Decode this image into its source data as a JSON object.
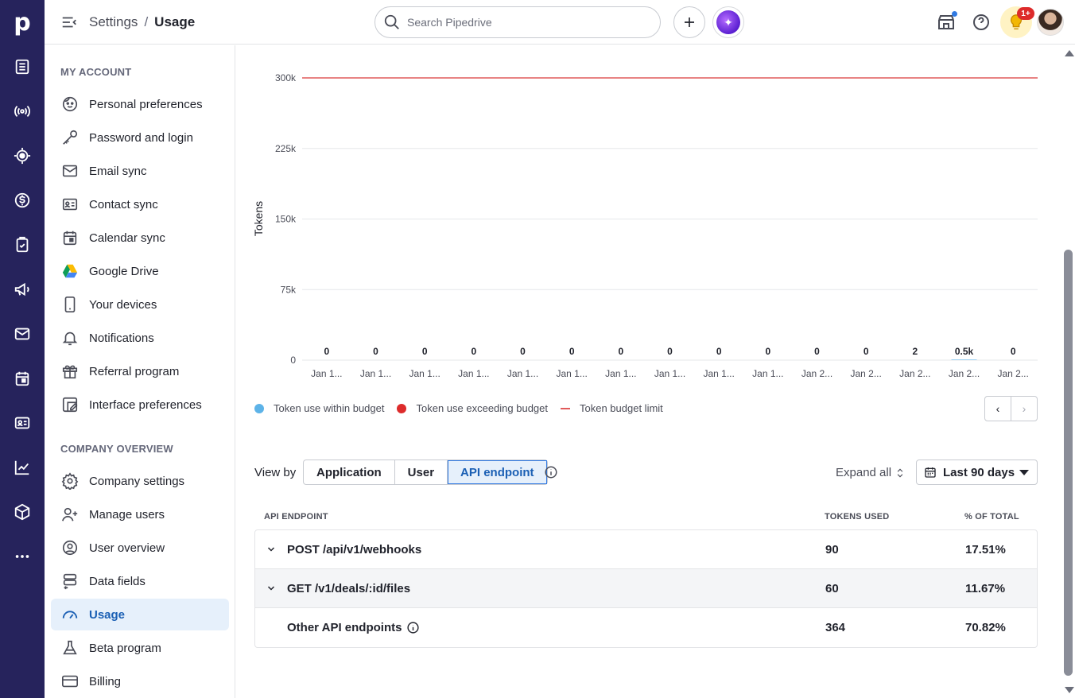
{
  "app": {
    "logo": "p"
  },
  "rail": {
    "items": [
      {
        "icon": "leads-icon"
      },
      {
        "icon": "broadcast-icon"
      },
      {
        "icon": "target-icon"
      },
      {
        "icon": "dollar-icon"
      },
      {
        "icon": "clipboard-icon"
      },
      {
        "icon": "megaphone-icon"
      },
      {
        "icon": "mail-icon"
      },
      {
        "icon": "calendar-icon"
      },
      {
        "icon": "contacts-icon"
      },
      {
        "icon": "chart-icon"
      },
      {
        "icon": "box-icon"
      },
      {
        "icon": "more-icon"
      }
    ]
  },
  "header": {
    "breadcrumb_root": "Settings",
    "breadcrumb_sep": "/",
    "breadcrumb_current": "Usage",
    "search_placeholder": "Search Pipedrive",
    "notification_badge": "1+"
  },
  "sidebar": {
    "section1": "MY ACCOUNT",
    "items1": [
      {
        "label": "Personal preferences",
        "icon": "face-icon"
      },
      {
        "label": "Password and login",
        "icon": "key-icon"
      },
      {
        "label": "Email sync",
        "icon": "envelope-icon"
      },
      {
        "label": "Contact sync",
        "icon": "contact-card-icon"
      },
      {
        "label": "Calendar sync",
        "icon": "calendar-icon"
      },
      {
        "label": "Google Drive",
        "icon": "google-drive-icon"
      },
      {
        "label": "Your devices",
        "icon": "phone-icon"
      },
      {
        "label": "Notifications",
        "icon": "bell-icon"
      },
      {
        "label": "Referral program",
        "icon": "gift-icon"
      },
      {
        "label": "Interface preferences",
        "icon": "interface-icon"
      }
    ],
    "section2": "COMPANY OVERVIEW",
    "items2": [
      {
        "label": "Company settings",
        "icon": "gear-icon"
      },
      {
        "label": "Manage users",
        "icon": "users-icon"
      },
      {
        "label": "User overview",
        "icon": "user-circle-icon"
      },
      {
        "label": "Data fields",
        "icon": "data-fields-icon"
      },
      {
        "label": "Usage",
        "icon": "gauge-icon",
        "active": true
      },
      {
        "label": "Beta program",
        "icon": "flask-icon"
      },
      {
        "label": "Billing",
        "icon": "credit-card-icon"
      }
    ]
  },
  "chart_data": {
    "type": "bar",
    "ylabel": "Tokens",
    "ylim": [
      0,
      300000
    ],
    "yticks": [
      "0",
      "75k",
      "150k",
      "225k",
      "300k"
    ],
    "categories": [
      "Jan 1...",
      "Jan 1...",
      "Jan 1...",
      "Jan 1...",
      "Jan 1...",
      "Jan 1...",
      "Jan 1...",
      "Jan 1...",
      "Jan 1...",
      "Jan 1...",
      "Jan 2...",
      "Jan 2...",
      "Jan 2...",
      "Jan 2...",
      "Jan 2..."
    ],
    "values": [
      0,
      0,
      0,
      0,
      0,
      0,
      0,
      0,
      0,
      0,
      0,
      0,
      2,
      500,
      0
    ],
    "value_labels": [
      "0",
      "0",
      "0",
      "0",
      "0",
      "0",
      "0",
      "0",
      "0",
      "0",
      "0",
      "0",
      "2",
      "0.5k",
      "0"
    ],
    "budget_limit": 300000,
    "legend": [
      {
        "label": "Token use within budget",
        "color": "#5db3e8",
        "kind": "dot"
      },
      {
        "label": "Token use exceeding budget",
        "color": "#dd2b2b",
        "kind": "dot"
      },
      {
        "label": "Token budget limit",
        "color": "#e15a5a",
        "kind": "line"
      }
    ],
    "grid": true,
    "legend_position": "bottom-left"
  },
  "controls": {
    "view_by_label": "View by",
    "tabs": [
      "Application",
      "User",
      "API endpoint"
    ],
    "active_tab": "API endpoint",
    "expand_all": "Expand all",
    "date_range": "Last 90 days"
  },
  "table": {
    "headers": [
      "API ENDPOINT",
      "TOKENS USED",
      "% OF TOTAL"
    ],
    "rows": [
      {
        "endpoint": "POST /api/v1/webhooks",
        "tokens": "90",
        "pct": "17.51%",
        "expandable": true
      },
      {
        "endpoint": "GET /v1/deals/:id/files",
        "tokens": "60",
        "pct": "11.67%",
        "expandable": true
      },
      {
        "endpoint": "Other API endpoints",
        "tokens": "364",
        "pct": "70.82%",
        "expandable": false
      }
    ]
  }
}
